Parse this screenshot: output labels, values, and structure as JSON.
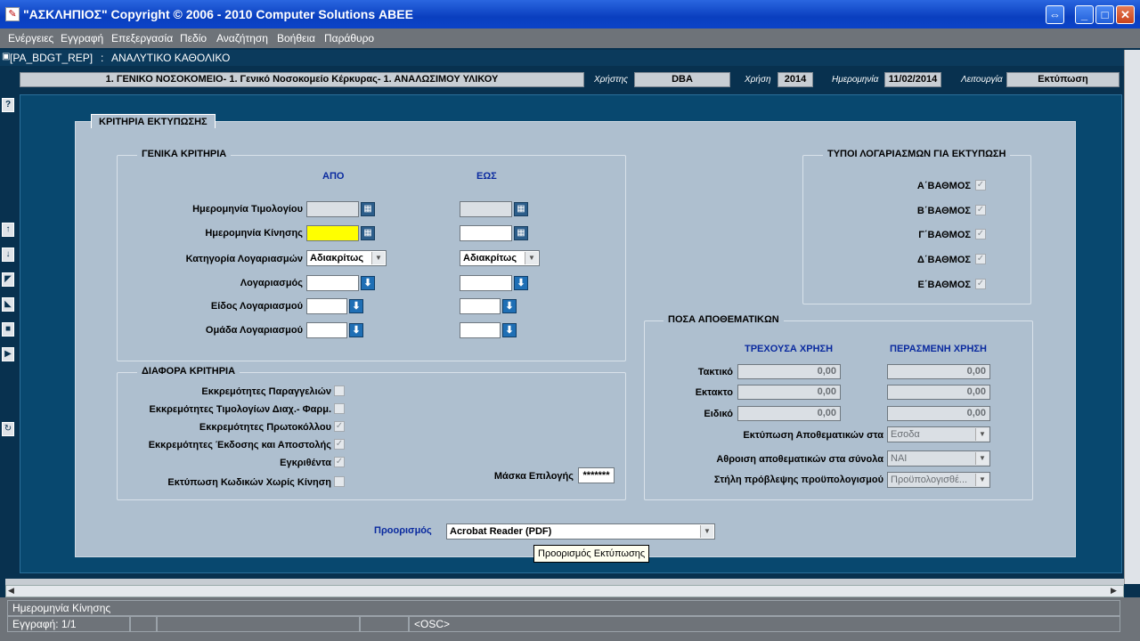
{
  "window": {
    "title": "\"ΑΣΚΛΗΠΙΟΣ\" Copyright © 2006 - 2010 Computer Solutions ΑΒΕΕ"
  },
  "menu": [
    "Ενέργειες",
    "Εγγραφή",
    "Επεξεργασία",
    "Πεδίο",
    "Αναζήτηση",
    "Βοήθεια",
    "Παράθυρο"
  ],
  "form": {
    "code": "[PA_BDGT_REP]",
    "sep": ":",
    "name": "ΑΝΑΛΥΤΙΚΟ ΚΑΘΟΛΙΚΟ"
  },
  "info": {
    "org": "1. ΓΕΝΙΚΟ ΝΟΣΟΚΟΜΕΙΟ- 1. Γενικό Νοσοκομείο Κέρκυρας- 1. ΑΝΑΛΩΣΙΜΟΥ ΥΛΙΚΟΥ",
    "user_label": "Χρήστης",
    "user": "DBA",
    "year_label": "Χρήση",
    "year": "2014",
    "date_label": "Ημερομηνία",
    "date": "11/02/2014",
    "mode_label": "Λειτουργία",
    "mode": "Εκτύπωση"
  },
  "panel_title": "ΚΡΙΤΗΡΙΑ ΕΚΤΥΠΩΣΗΣ",
  "general": {
    "title": "ΓΕΝΙΚΑ ΚΡΙΤΗΡΙΑ",
    "from": "ΑΠΟ",
    "to": "ΕΩΣ",
    "rows": [
      {
        "label": "Ημερομηνία Τιμολογίου"
      },
      {
        "label": "Ημερομηνία Κίνησης"
      },
      {
        "label": "Κατηγορία Λογαριασμών",
        "from_value": "Αδιακρίτως",
        "to_value": "Αδιακρίτως"
      },
      {
        "label": "Λογαριασμός"
      },
      {
        "label": "Είδος Λογαριασμού"
      },
      {
        "label": "Ομάδα Λογαριασμού"
      }
    ]
  },
  "account_types": {
    "title": "ΤΥΠΟΙ ΛΟΓΑΡΙΑΣΜΩΝ ΓΙΑ ΕΚΤΥΠΩΣΗ",
    "items": [
      "Α΄ΒΑΘΜΟΣ",
      "Β΄ΒΑΘΜΟΣ",
      "Γ΄ΒΑΘΜΟΣ",
      "Δ΄ΒΑΘΜΟΣ",
      "Ε΄ΒΑΘΜΟΣ"
    ]
  },
  "misc": {
    "title": "ΔΙΑΦΟΡΑ ΚΡΙΤΗΡΙΑ",
    "items": [
      "Εκκρεμότητες Παραγγελιών",
      "Εκκρεμότητες Τιμολογίων Διαχ.- Φαρμ.",
      "Εκκρεμότητες Πρωτοκόλλου",
      "Εκκρεμότητες Έκδοσης και Αποστολής",
      "Εγκριθέντα",
      "Εκτύπωση Κωδικών Χωρίς Κίνηση"
    ],
    "mask_label": "Μάσκα Επιλογής",
    "mask_value": "*******"
  },
  "reserves": {
    "title": "ΠΟΣΑ ΑΠΟΘΕΜΑΤΙΚΩΝ",
    "current": "ΤΡΕΧΟΥΣΑ ΧΡΗΣΗ",
    "previous": "ΠΕΡΑΣΜΕΝΗ ΧΡΗΣΗ",
    "rows": [
      {
        "label": "Τακτικό",
        "current": "0,00",
        "previous": "0,00"
      },
      {
        "label": "Εκτακτο",
        "current": "0,00",
        "previous": "0,00"
      },
      {
        "label": "Ειδικό",
        "current": "0,00",
        "previous": "0,00"
      }
    ],
    "print_label": "Εκτύπωση Αποθεματικών στα",
    "print_value": "Εσοδα",
    "sum_label": "Αθροιση αποθεματικών στα σύνολα",
    "sum_value": "ΝΑΙ",
    "budget_label": "Στήλη πρόβλεψης προϋπολογισμού",
    "budget_value": "Προϋπολογισθέ..."
  },
  "destination": {
    "label": "Προορισμός",
    "value": "Acrobat Reader (PDF)",
    "tooltip": "Προορισμός Εκτύπωσης"
  },
  "status": {
    "field": "Ημερομηνία Κίνησης",
    "record": "Εγγραφή: 1/1",
    "osc": "<OSC>"
  }
}
